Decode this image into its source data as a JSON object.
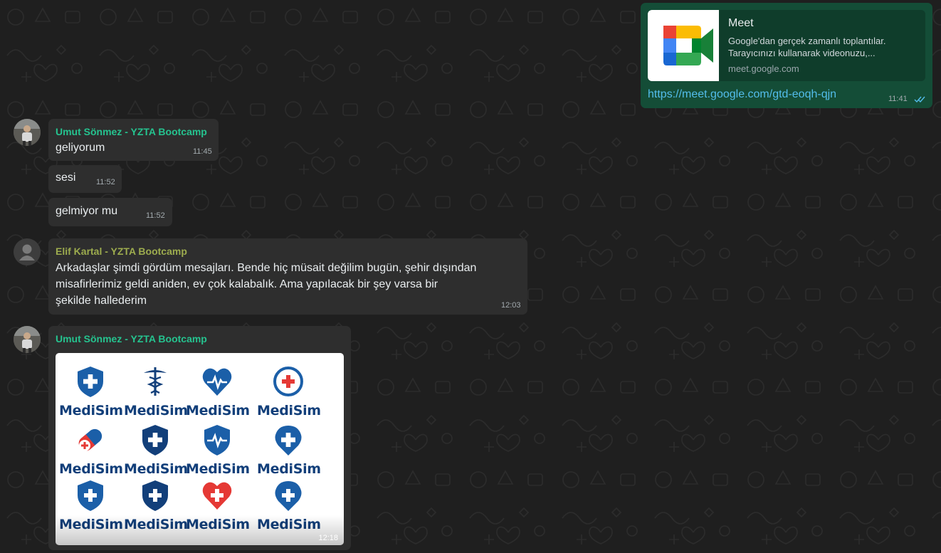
{
  "chat": {
    "outgoing_link": {
      "card_title": "Meet",
      "card_desc_line1": "Google'dan gerçek zamanlı toplantılar.",
      "card_desc_line2": "Tarayıcınızı kullanarak videonuzu,...",
      "card_domain": "meet.google.com",
      "url_text": "https://meet.google.com/gtd-eoqh-qjn",
      "time": "11:41",
      "status_icon": "double-check-icon"
    },
    "group1": {
      "sender": "Umut Sönmez - YZTA Bootcamp",
      "sender_color": "#25c38f",
      "messages": [
        {
          "text": "geliyorum",
          "time": "11:45"
        },
        {
          "text": "sesi",
          "time": "11:52"
        },
        {
          "text": "gelmiyor mu",
          "time": "11:52"
        }
      ]
    },
    "group2": {
      "sender": "Elif Kartal - YZTA Bootcamp",
      "sender_color": "#9dac4e",
      "lines": [
        "Arkadaşlar şimdi gördüm mesajları. Bende hiç müsait değilim bugün, şehir dışından",
        "misafirlerimiz geldi aniden, ev çok kalabalık. Ama yapılacak bir şey varsa bir",
        "şekilde hallederim"
      ],
      "time": "12:03"
    },
    "group3": {
      "sender": "Umut Sönmez - YZTA Bootcamp",
      "sender_color": "#25c38f",
      "image_logo_text": "MediSim",
      "time": "12:18"
    }
  }
}
